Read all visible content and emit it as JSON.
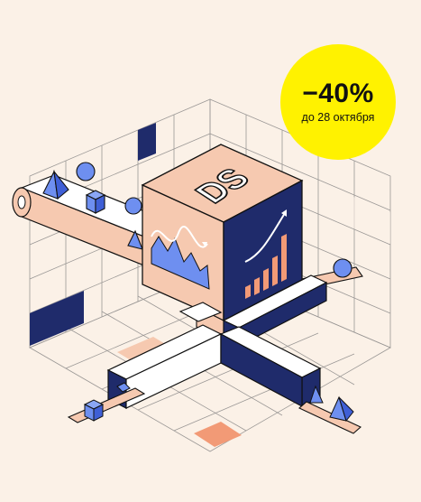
{
  "promo": {
    "discount": "−40%",
    "until": "до 28 октября",
    "badge_color": "#fff200"
  },
  "cube": {
    "logo_text": "DS"
  },
  "colors": {
    "background": "#fbf1e7",
    "navy": "#1f2b6b",
    "peach": "#f6c9b0",
    "salmon": "#f29a76",
    "blue": "#6e8ff0",
    "grid": "#8f8c8a"
  },
  "icons": [
    "pyramid-icon",
    "sphere-icon",
    "cube-icon",
    "wave-chart-icon",
    "bar-chart-icon"
  ]
}
